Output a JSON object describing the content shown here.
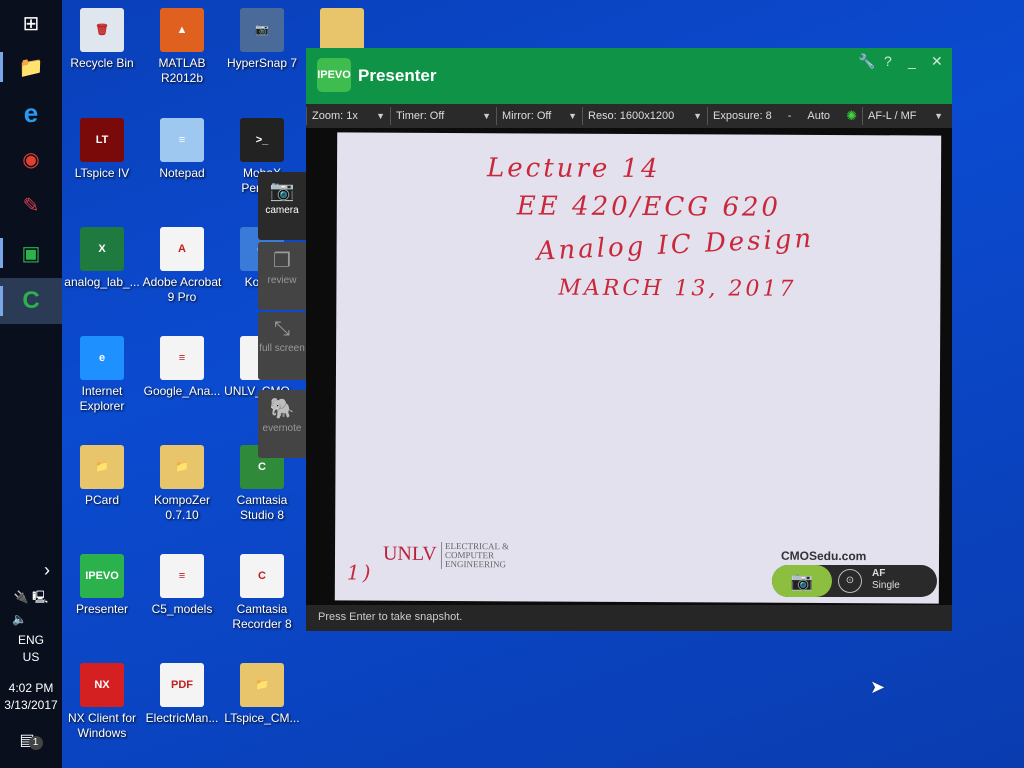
{
  "taskbar": {
    "apps": [
      {
        "name": "start",
        "glyph": "⊞"
      },
      {
        "name": "file-explorer",
        "glyph": "📁"
      },
      {
        "name": "internet-explorer",
        "glyph": "e"
      },
      {
        "name": "chrome",
        "glyph": "◉"
      },
      {
        "name": "app",
        "glyph": "✎"
      },
      {
        "name": "presenter",
        "glyph": "▣"
      },
      {
        "name": "camtasia",
        "glyph": "C"
      }
    ],
    "tray": {
      "chevron": "›",
      "language": "ENG",
      "region": "US",
      "time": "4:02 PM",
      "date": "3/13/2017",
      "notifications": "1"
    }
  },
  "desktop_icons": [
    {
      "label": "Recycle Bin",
      "glyph": "🗑",
      "color": "#dfe6ee"
    },
    {
      "label": "LTspice IV",
      "glyph": "LT",
      "color": "#7a0a0a"
    },
    {
      "label": "analog_lab_...",
      "glyph": "X",
      "color": "#1e7a3e"
    },
    {
      "label": "Internet Explorer",
      "glyph": "e",
      "color": "#1e90ff"
    },
    {
      "label": "PCard",
      "glyph": "📁",
      "color": "#e8c46a"
    },
    {
      "label": "Presenter",
      "glyph": "IPEVO",
      "color": "#2bb24c"
    },
    {
      "label": "NX Client for Windows",
      "glyph": "NX",
      "color": "#d42020"
    },
    {
      "label": "MATLAB R2012b",
      "glyph": "▲",
      "color": "#e06020"
    },
    {
      "label": "Notepad",
      "glyph": "≡",
      "color": "#9ec8f0"
    },
    {
      "label": "Adobe Acrobat 9 Pro",
      "glyph": "A",
      "color": "#f4f4f4"
    },
    {
      "label": "Google_Ana...",
      "glyph": "≡",
      "color": "#f4f4f4"
    },
    {
      "label": "KompoZer 0.7.10",
      "glyph": "📁",
      "color": "#e8c46a"
    },
    {
      "label": "C5_models",
      "glyph": "≡",
      "color": "#f4f4f4"
    },
    {
      "label": "ElectricMan...",
      "glyph": "PDF",
      "color": "#f4f4f4"
    },
    {
      "label": "HyperSnap 7",
      "glyph": "📷",
      "color": "#4a6a9a"
    },
    {
      "label": "MobaX Perso...",
      "glyph": ">_",
      "color": "#222"
    },
    {
      "label": "Kom...",
      "glyph": "◍",
      "color": "#3a7ad8"
    },
    {
      "label": "UNLV_CMO...",
      "glyph": "",
      "color": "#f4f4f4"
    },
    {
      "label": "Camtasia Studio 8",
      "glyph": "C",
      "color": "#2f8a3a"
    },
    {
      "label": "Camtasia Recorder 8",
      "glyph": "C",
      "color": "#f4f4f4"
    },
    {
      "label": "LTspice_CM...",
      "glyph": "📁",
      "color": "#e8c46a"
    }
  ],
  "presenter": {
    "logo": "IPEVO",
    "title": "Presenter",
    "window_controls": {
      "settings": "🔧",
      "help": "?",
      "minimize": "_",
      "close": "✕"
    },
    "toolbar": {
      "zoom": "Zoom: 1x",
      "timer": "Timer: Off",
      "mirror": "Mirror: Off",
      "reso": "Reso: 1600x1200",
      "exposure": "Exposure: 8",
      "exposure_minus": "-",
      "exposure_auto": "Auto",
      "focus": "AF-L / MF"
    },
    "side_panel": {
      "camera": "camera",
      "review": "review",
      "fullscreen": "full screen",
      "evernote": "evernote"
    },
    "video": {
      "lines": [
        "Lecture 14",
        "EE 420/ECG 620",
        "Analog IC Design",
        "MARCH 13, 2017"
      ],
      "page_mark": "1)",
      "unlv": "UNLV",
      "dept": "ELECTRICAL & COMPUTER ENGINEERING",
      "site": "CMOSedu.com"
    },
    "af_label": "AF",
    "af_mode": "Single",
    "status": "Press Enter to take snapshot."
  }
}
